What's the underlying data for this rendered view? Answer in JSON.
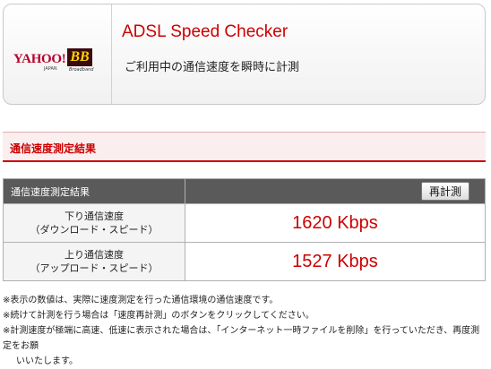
{
  "header": {
    "logo_yahoo": "YAHOO!",
    "logo_japan": "JAPAN",
    "logo_bb": "BB",
    "logo_bb_sub": "Broadband",
    "title": "ADSL Speed Checker",
    "subtitle": "ご利用中の通信速度を瞬時に計測"
  },
  "section": {
    "heading": "通信速度測定結果"
  },
  "results": {
    "header_label": "通信速度測定結果",
    "retest_label": "再計測",
    "rows": [
      {
        "label_line1": "下り通信速度",
        "label_line2": "（ダウンロード・スピード）",
        "value": "1620 Kbps"
      },
      {
        "label_line1": "上り通信速度",
        "label_line2": "（アップロード・スピード）",
        "value": "1527 Kbps"
      }
    ]
  },
  "notes": [
    "※表示の数値は、実際に速度測定を行った通信環境の通信速度です。",
    "※続けて計測を行う場合は「速度再計測」のボタンをクリックしてください。",
    "※計測速度が極端に高速、低速に表示された場合は、「インターネット一時ファイルを削除」を行っていただき、再度測定をお願",
    "いいたします。"
  ]
}
